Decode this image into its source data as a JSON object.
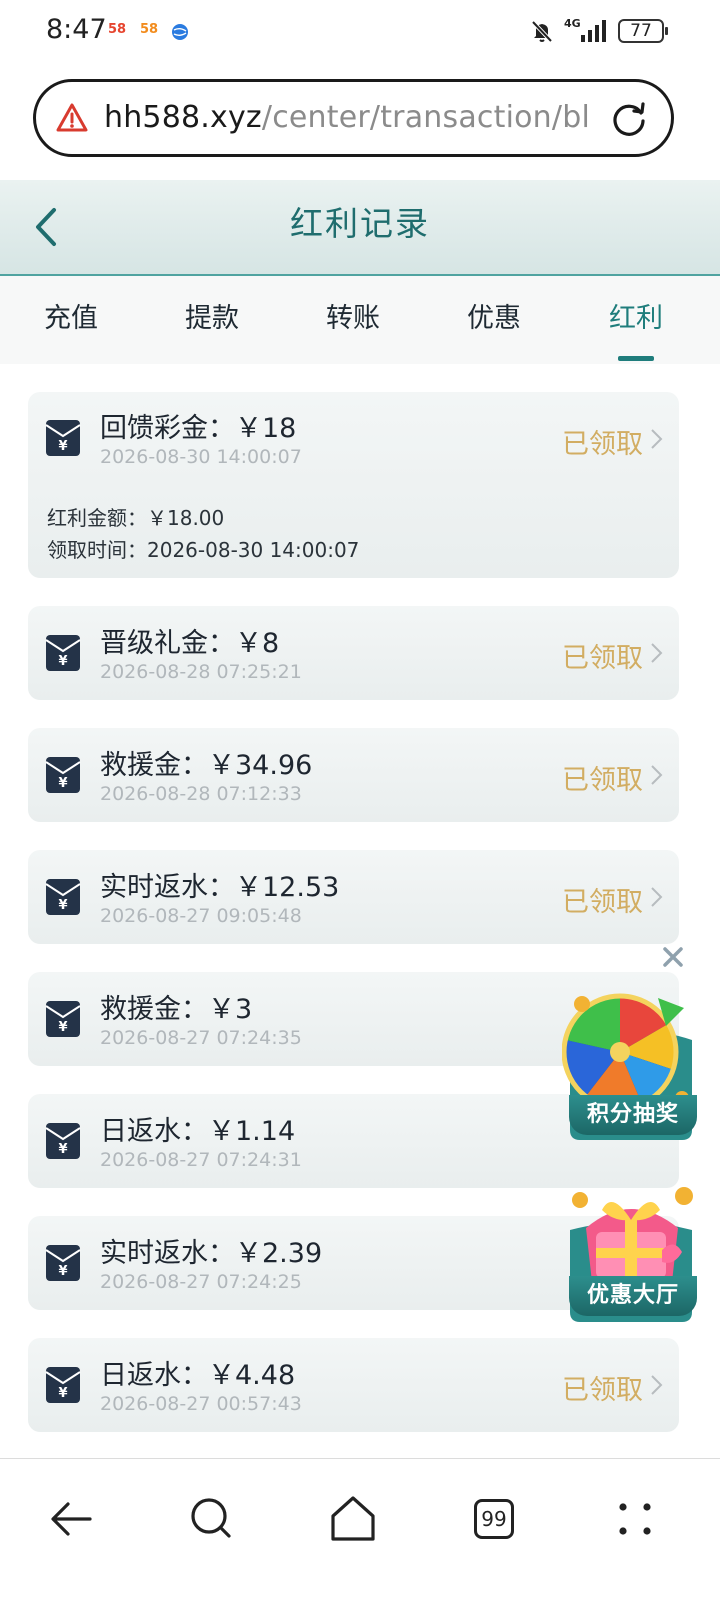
{
  "status_bar": {
    "time": "8:47",
    "apps": [
      "58",
      "58"
    ],
    "network": "4G",
    "battery": "77"
  },
  "browser": {
    "url_host": "hh588.xyz",
    "url_path": "/center/transaction/blo",
    "tabs_count": "99"
  },
  "header": {
    "title": "红利记录"
  },
  "tabs": [
    {
      "label": "充值"
    },
    {
      "label": "提款"
    },
    {
      "label": "转账"
    },
    {
      "label": "优惠"
    },
    {
      "label": "红利",
      "active": true
    }
  ],
  "records": [
    {
      "title": "回馈彩金：￥18",
      "date": "2026-08-30 14:00:07",
      "status": "已领取",
      "details": [
        "红利金额：￥18.00",
        "领取时间：2026-08-30 14:00:07"
      ]
    },
    {
      "title": "晋级礼金：￥8",
      "date": "2026-08-28 07:25:21",
      "status": "已领取"
    },
    {
      "title": "救援金：￥34.96",
      "date": "2026-08-28 07:12:33",
      "status": "已领取"
    },
    {
      "title": "实时返水：￥12.53",
      "date": "2026-08-27 09:05:48",
      "status": "已领取"
    },
    {
      "title": "救援金：￥3",
      "date": "2026-08-27 07:24:35",
      "status": ""
    },
    {
      "title": "日返水：￥1.14",
      "date": "2026-08-27 07:24:31",
      "status": ""
    },
    {
      "title": "实时返水：￥2.39",
      "date": "2026-08-27 07:24:25",
      "status": ""
    },
    {
      "title": "日返水：￥4.48",
      "date": "2026-08-27 00:57:43",
      "status": "已领取"
    }
  ],
  "floating": {
    "lottery_label": "积分抽奖",
    "promo_label": "优惠大厅"
  },
  "colors": {
    "accent": "#1f7d7c",
    "status": "#d2ad62",
    "date": "#b1b7bb"
  }
}
